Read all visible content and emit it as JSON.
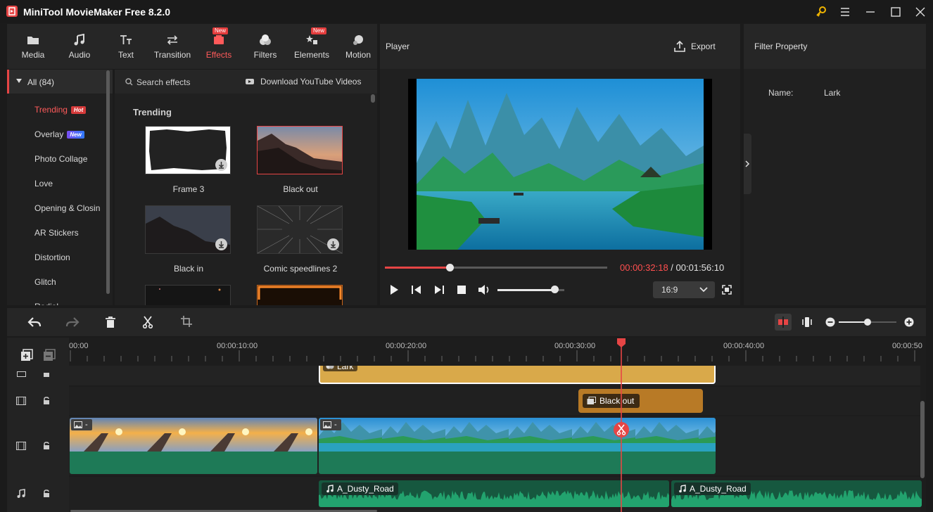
{
  "app": {
    "title": "MiniTool MovieMaker Free 8.2.0"
  },
  "categories": [
    {
      "label": "Media",
      "icon": "media-folder-icon"
    },
    {
      "label": "Audio",
      "icon": "music-note-icon"
    },
    {
      "label": "Text",
      "icon": "text-tt-icon"
    },
    {
      "label": "Transition",
      "icon": "transition-arrows-icon"
    },
    {
      "label": "Effects",
      "icon": "effects-icon",
      "badge": "New",
      "active": true
    },
    {
      "label": "Filters",
      "icon": "filters-icon"
    },
    {
      "label": "Elements",
      "icon": "elements-icon",
      "badge": "New"
    },
    {
      "label": "Motion",
      "icon": "motion-icon"
    }
  ],
  "left_panel": {
    "all_label": "All (84)",
    "items": [
      {
        "label": "Trending",
        "badge": "Hot",
        "active": true
      },
      {
        "label": "Overlay",
        "badge": "New"
      },
      {
        "label": "Photo Collage"
      },
      {
        "label": "Love"
      },
      {
        "label": "Opening & Closin"
      },
      {
        "label": "AR Stickers"
      },
      {
        "label": "Distortion"
      },
      {
        "label": "Glitch"
      },
      {
        "label": "Radial"
      }
    ]
  },
  "browser": {
    "search_placeholder": "Search effects",
    "download_label": "Download YouTube Videos",
    "section_title": "Trending",
    "effects": [
      {
        "label": "Frame 3"
      },
      {
        "label": "Black out"
      },
      {
        "label": "Black in"
      },
      {
        "label": "Comic speedlines 2"
      }
    ]
  },
  "player": {
    "title": "Player",
    "export_label": "Export",
    "current_time": "00:00:32:18",
    "separator": " / ",
    "total_time": "00:01:56:10",
    "progress": 0.29,
    "volume": 0.85,
    "aspect_ratio": "16:9"
  },
  "filter_property": {
    "title": "Filter Property",
    "name_label": "Name:",
    "name_value": "Lark"
  },
  "timeline": {
    "ruler_labels": [
      "00:00",
      "00:00:10:00",
      "00:00:20:00",
      "00:00:30:00",
      "00:00:40:00",
      "00:00:50"
    ],
    "clips": {
      "filter_clip": "Lark",
      "effect_clip": "Black out",
      "video_clip_1": "-",
      "video_clip_2": "-",
      "audio_clip_1": "A_Dusty_Road",
      "audio_clip_2": "A_Dusty_Road"
    },
    "zoom": 0.5
  },
  "colors": {
    "accent": "#e64545",
    "filter_clip": "#d9a94a",
    "effect_clip": "#b87a26",
    "video_track": "#1e7a57",
    "audio_track": "#1f8a5e"
  }
}
